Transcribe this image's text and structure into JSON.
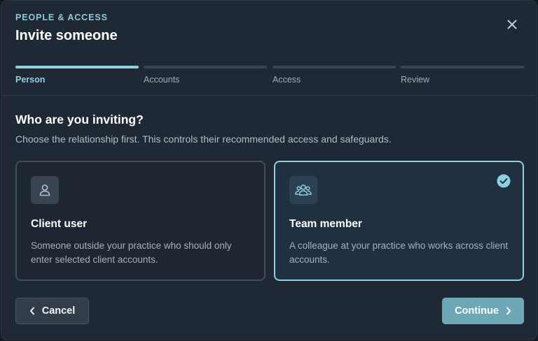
{
  "header": {
    "eyebrow": "PEOPLE & ACCESS",
    "title": "Invite someone",
    "close_icon": "close-icon"
  },
  "steps": [
    {
      "label": "Person",
      "state": "active"
    },
    {
      "label": "Accounts",
      "state": "upcoming"
    },
    {
      "label": "Access",
      "state": "upcoming"
    },
    {
      "label": "Review",
      "state": "upcoming"
    }
  ],
  "body": {
    "question": "Who are you inviting?",
    "helper": "Choose the relationship first. This controls their recommended access and safeguards."
  },
  "options": [
    {
      "title": "Client user",
      "description": "Someone outside your practice who should only enter selected client accounts.",
      "icon": "person-icon",
      "selected": false
    },
    {
      "title": "Team member",
      "description": "A colleague at your practice who works across client accounts.",
      "icon": "team-icon",
      "selected": true
    }
  ],
  "footer": {
    "cancel_label": "Cancel",
    "continue_label": "Continue"
  },
  "colors": {
    "accent": "#8fd0e0",
    "primary_button": "#6ea7b6",
    "modal_background": "#1f2935"
  }
}
